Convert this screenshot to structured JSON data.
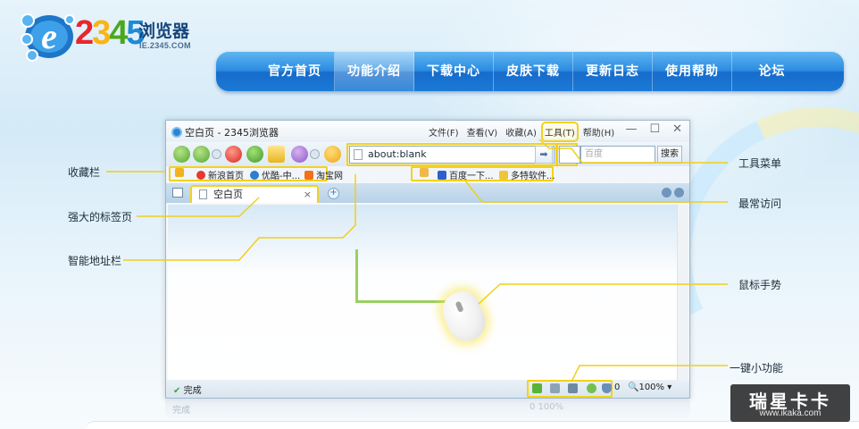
{
  "logo": {
    "number": [
      "2",
      "3",
      "4",
      "5"
    ],
    "name": "浏览器",
    "url": "IE.2345.COM"
  },
  "nav": {
    "items": [
      "官方首页",
      "功能介绍",
      "下载中心",
      "皮肤下载",
      "更新日志",
      "使用帮助",
      "论坛"
    ],
    "active_index": 1
  },
  "browser": {
    "title": "空白页 - 2345浏览器",
    "menu": [
      "文件(F)",
      "查看(V)",
      "收藏(A)",
      "工具(T)",
      "帮助(H)"
    ],
    "window_controls": [
      "—",
      "☐",
      "✕"
    ],
    "address": "about:blank",
    "search_placeholder": "百度",
    "search_button": "搜索",
    "favorites_left": [
      "新浪首页",
      "优酷-中...",
      "淘宝网"
    ],
    "favorites_right": [
      "百度一下...",
      "多特软件..."
    ],
    "tab_title": "空白页",
    "tab_close": "×",
    "tab_new": "+",
    "status_text": "完成",
    "status_counter": "0",
    "zoom": "100%"
  },
  "callouts": {
    "favorites": "收藏栏",
    "tabs": "强大的标签页",
    "address_bar": "智能地址栏",
    "tools_menu": "工具菜单",
    "frequent": "最常访问",
    "mouse_gesture": "鼠标手势",
    "one_key": "一键小功能"
  },
  "reflection": {
    "left": "完成",
    "right": "0  100%"
  },
  "watermark": {
    "title": "瑞星卡卡",
    "url": "www.ikaka.com"
  },
  "colors": {
    "nav_blue": "#2a8ae0",
    "highlight_yellow": "#f3d219",
    "gesture_green": "#9ad060"
  }
}
